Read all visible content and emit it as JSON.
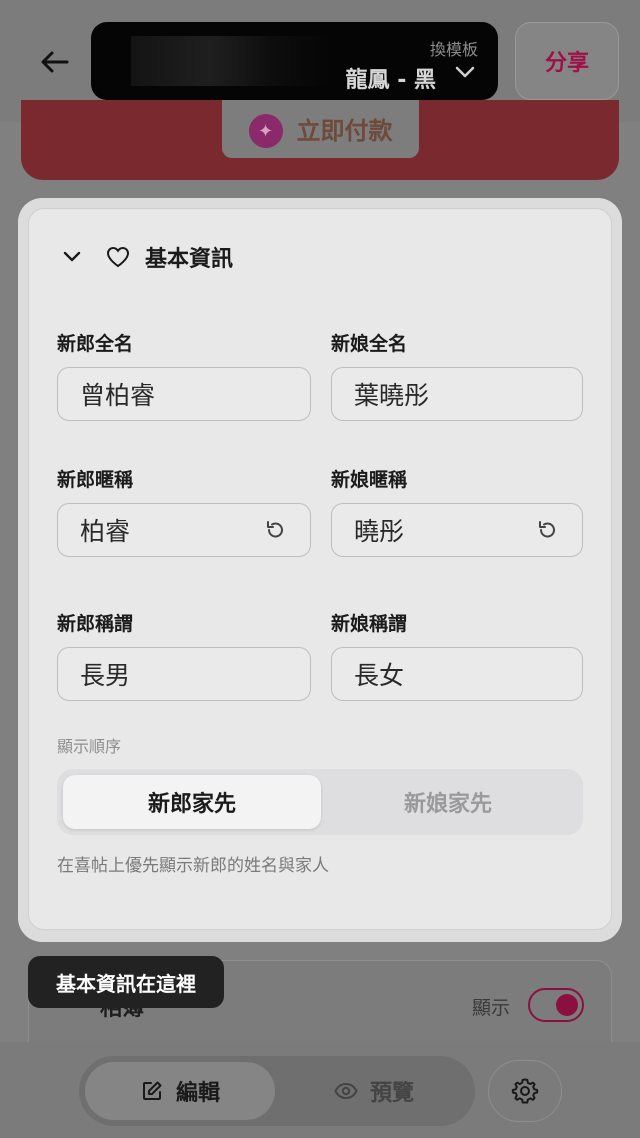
{
  "header": {
    "template_hint": "換模板",
    "template_name": "龍鳳 - 黑",
    "share_label": "分享"
  },
  "pay_banner": {
    "label": "立即付款"
  },
  "basic_info": {
    "title": "基本資訊",
    "groom_full_name": {
      "label": "新郎全名",
      "value": "曾柏睿"
    },
    "bride_full_name": {
      "label": "新娘全名",
      "value": "葉曉彤"
    },
    "groom_nickname": {
      "label": "新郎暱稱",
      "value": "柏睿"
    },
    "bride_nickname": {
      "label": "新娘暱稱",
      "value": "曉彤"
    },
    "groom_title": {
      "label": "新郎稱謂",
      "value": "長男"
    },
    "bride_title": {
      "label": "新娘稱謂",
      "value": "長女"
    },
    "display_order": {
      "label": "顯示順序",
      "options": [
        "新郎家先",
        "新娘家先"
      ],
      "selected": "新郎家先",
      "help": "在喜帖上優先顯示新郎的姓名與家人"
    }
  },
  "lower_section": {
    "title": "相簿",
    "show_label": "顯示",
    "show_enabled": true
  },
  "tooltip": "基本資訊在這裡",
  "bottom_bar": {
    "edit_label": "編輯",
    "preview_label": "預覽"
  },
  "colors": {
    "accent": "#d0155e",
    "toggle": "#8a1040"
  }
}
